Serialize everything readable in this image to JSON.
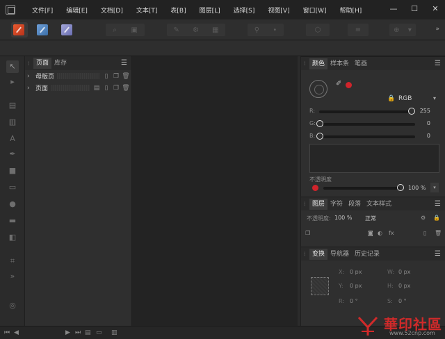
{
  "menu": {
    "items": [
      "文件[F]",
      "编辑[E]",
      "文档[D]",
      "文本[T]",
      "表[B]",
      "图层[L]",
      "选择[S]",
      "视图[V]",
      "窗口[W]",
      "帮助[H]"
    ],
    "window_controls": [
      "minimize-icon",
      "maximize-icon",
      "close-icon"
    ]
  },
  "pages_panel": {
    "tabs": [
      "页面",
      "库存"
    ],
    "rows": [
      {
        "label": "母版页"
      },
      {
        "label": "页面"
      }
    ]
  },
  "color_panel": {
    "tabs": [
      "颜色",
      "样本条",
      "笔画"
    ],
    "model": "RGB",
    "channels": [
      {
        "label": "R:",
        "value": "255",
        "fraction": 1.0
      },
      {
        "label": "G:",
        "value": "0",
        "fraction": 0.0
      },
      {
        "label": "B:",
        "value": "0",
        "fraction": 0.0
      }
    ],
    "opacity_label": "不透明度",
    "opacity_value": "100 %",
    "accent": "#d0242b"
  },
  "layers_panel": {
    "tabs": [
      "图层",
      "字符",
      "段落",
      "文本样式"
    ],
    "opacity_label": "不透明度:",
    "opacity_value": "100 %",
    "blend_mode": "正常"
  },
  "transform_panel": {
    "tabs": [
      "变换",
      "导航器",
      "历史记录"
    ],
    "x_label": "X:",
    "x_value": "0 px",
    "y_label": "Y:",
    "y_value": "0 px",
    "w_label": "W:",
    "w_value": "0 px",
    "h_label": "H:",
    "h_value": "0 px",
    "r_label": "R:",
    "r_value": "0 °",
    "s_label": "S:",
    "s_value": "0 °"
  },
  "watermark": {
    "text": "華印社區",
    "url": "www.52cnp.com"
  }
}
